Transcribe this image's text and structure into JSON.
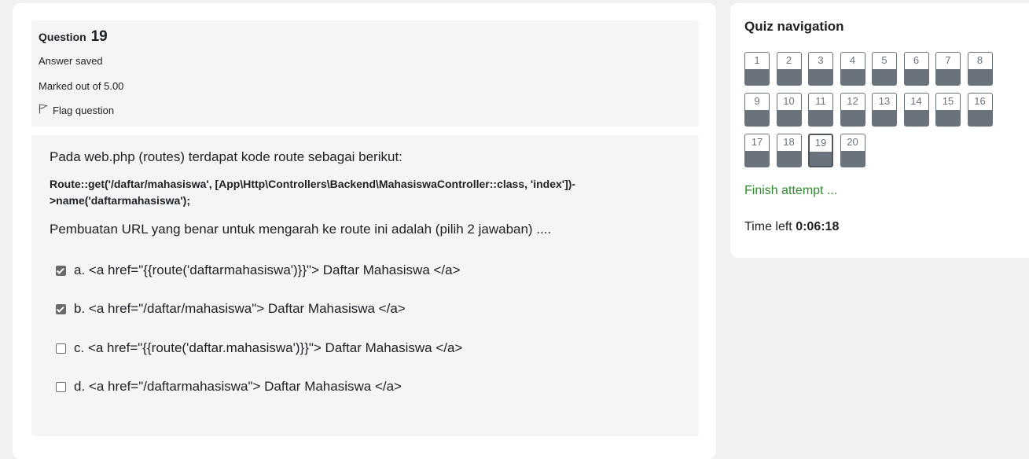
{
  "question": {
    "label": "Question",
    "number": "19",
    "status": "Answer saved",
    "marks": "Marked out of 5.00",
    "flag_label": "Flag question",
    "flag_icon": "flag-icon"
  },
  "content": {
    "intro": "Pada web.php (routes) terdapat kode route sebagai berikut:",
    "code_line1": "Route::get('/daftar/mahasiswa', [App\\Http\\Controllers\\Backend\\MahasiswaController::class, 'index'])-",
    "code_line2": ">name('daftarmahasiswa');",
    "prompt": "Pembuatan URL yang benar untuk mengarah ke route ini adalah (pilih 2 jawaban) ....",
    "answers": [
      {
        "text": "a. <a href=\"{{route('daftarmahasiswa')}}\"> Daftar Mahasiswa </a>",
        "checked": true
      },
      {
        "text": "b. <a href=\"/daftar/mahasiswa\"> Daftar Mahasiswa </a>",
        "checked": true
      },
      {
        "text": "c. <a href=\"{{route('daftar.mahasiswa')}}\"> Daftar Mahasiswa </a>",
        "checked": false
      },
      {
        "text": "d. <a href=\"/daftarmahasiswa\"> Daftar Mahasiswa </a>",
        "checked": false
      }
    ]
  },
  "nav": {
    "title": "Quiz navigation",
    "buttons": [
      "1",
      "2",
      "3",
      "4",
      "5",
      "6",
      "7",
      "8",
      "9",
      "10",
      "11",
      "12",
      "13",
      "14",
      "15",
      "16",
      "17",
      "18",
      "19",
      "20"
    ],
    "current": "19",
    "finish_label": "Finish attempt ...",
    "time_label": "Time left",
    "time_value": "0:06:18"
  },
  "colors": {
    "accent_green": "#2c8b2e",
    "answered_gray": "#6a737b"
  }
}
